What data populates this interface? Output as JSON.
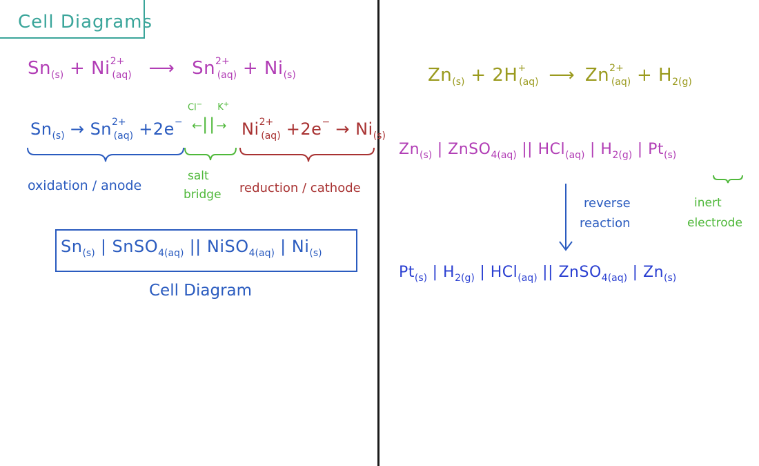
{
  "colors": {
    "title": "#3aa59a",
    "magenta": "#b13db5",
    "blue": "#2a5bbf",
    "green": "#4fb83a",
    "red": "#a83232",
    "olive": "#9a9a1e",
    "purple": "#6a3fc2"
  },
  "title": "Cell Diagrams",
  "left": {
    "reaction": {
      "a": "Sn",
      "a_state": "(s)",
      "plus1": "+",
      "b": "Ni",
      "b_charge": "2+",
      "b_state": "(aq)",
      "arrow": "⟶",
      "c": "Sn",
      "c_charge": "2+",
      "c_state": "(aq)",
      "plus2": "+",
      "d": "Ni",
      "d_state": "(s)"
    },
    "oxidation_half": {
      "a": "Sn",
      "a_state": "(s)",
      "arrow": "→",
      "b": "Sn",
      "b_charge": "2+",
      "b_state": "(aq)",
      "plus": "+2e",
      "e_charge": "−"
    },
    "bridge": {
      "anion": "Cl",
      "anion_charge": "−",
      "cation": "K",
      "cation_charge": "+",
      "left_arrow": "←",
      "bars": "||",
      "right_arrow": "→"
    },
    "reduction_half": {
      "a": "Ni",
      "a_charge": "2+",
      "a_state": "(aq)",
      "plus": "+2e",
      "e_charge": "−",
      "arrow": "→",
      "b": "Ni",
      "b_state": "(s)"
    },
    "label_oxidation": "oxidation / anode",
    "label_salt": "salt",
    "label_bridge": "bridge",
    "label_reduction": "reduction / cathode",
    "cell_diagram": {
      "sn": "Sn",
      "sn_state": "(s)",
      "bar1": "|",
      "snso4": "SnSO",
      "snso4_sub": "4(aq)",
      "double": "||",
      "niso4": "NiSO",
      "niso4_sub": "4(aq)",
      "bar2": "|",
      "ni": "Ni",
      "ni_state": "(s)"
    },
    "cell_caption": "Cell Diagram"
  },
  "right": {
    "reaction": {
      "a": "Zn",
      "a_state": "(s)",
      "plus1": "+",
      "b": "2H",
      "b_charge": "+",
      "b_state": "(aq)",
      "arrow": "⟶",
      "c": "Zn",
      "c_charge": "2+",
      "c_state": "(aq)",
      "plus2": "+",
      "d": "H",
      "d_sub": "2(g)"
    },
    "diagram1": {
      "zn": "Zn",
      "zn_state": "(s)",
      "bar1": "|",
      "znso4": "ZnSO",
      "znso4_sub": "4(aq)",
      "double": "||",
      "hcl": "HCl",
      "hcl_state": "(aq)",
      "bar2": "|",
      "h2": "H",
      "h2_sub": "2(g)",
      "bar3": "|",
      "pt": "Pt",
      "pt_state": "(s)"
    },
    "label_reverse": "reverse",
    "label_reaction": "reaction",
    "label_inert": "inert",
    "label_electrode": "electrode",
    "diagram2": {
      "pt": "Pt",
      "pt_state": "(s)",
      "bar1": "|",
      "h2": "H",
      "h2_sub": "2(g)",
      "bar2": "|",
      "hcl": "HCl",
      "hcl_state": "(aq)",
      "double": "||",
      "znso4": "ZnSO",
      "znso4_sub": "4(aq)",
      "bar3": "|",
      "zn": "Zn",
      "zn_state": "(s)"
    }
  }
}
